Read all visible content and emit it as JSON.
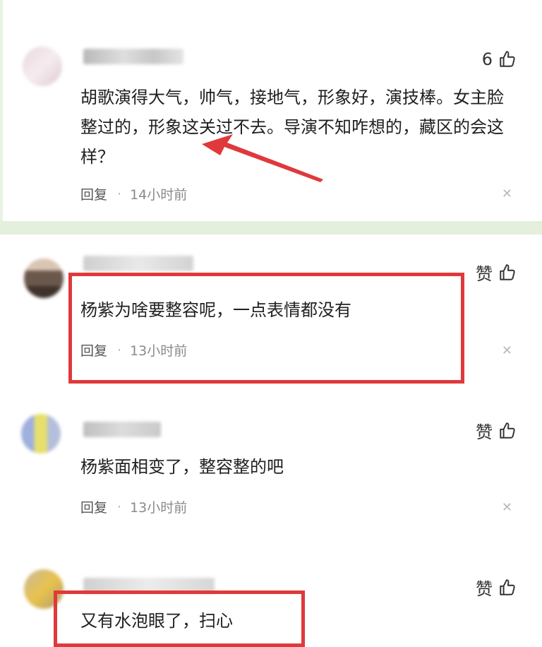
{
  "colors": {
    "highlight": "#e0393b",
    "section_divider": "#e5f0dc"
  },
  "comments": [
    {
      "like_label": "6",
      "text": "胡歌演得大气，帅气，接地气，形象好，演技棒。女主脸整过的，形象这关过不去。导演不知咋想的，藏区的会这样？",
      "reply_label": "回复",
      "time": "14小时前"
    },
    {
      "like_label": "赞",
      "text": "杨紫为啥要整容呢，一点表情都没有",
      "reply_label": "回复",
      "time": "13小时前"
    },
    {
      "like_label": "赞",
      "text": "杨紫面相变了，整容整的吧",
      "reply_label": "回复",
      "time": "13小时前"
    },
    {
      "like_label": "赞",
      "text": "又有水泡眼了，扫心"
    }
  ],
  "icons": {
    "like": "thumbs-up-icon",
    "close": "close-icon",
    "arrow": "red-arrow-annotation"
  }
}
